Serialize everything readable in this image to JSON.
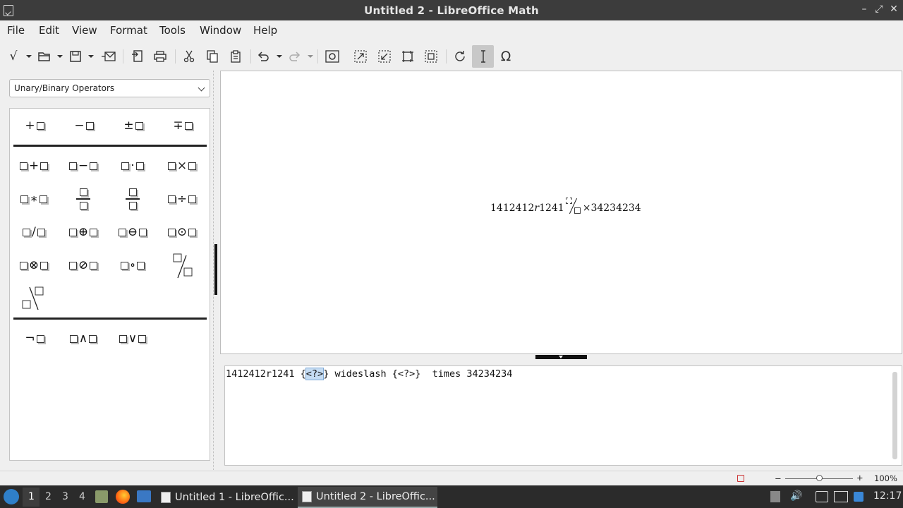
{
  "window": {
    "title": "Untitled 2 - LibreOffice Math",
    "controls": {
      "minimize": "–",
      "restore": "⤢",
      "close": "✕"
    }
  },
  "menubar": [
    "File",
    "Edit",
    "View",
    "Format",
    "Tools",
    "Window",
    "Help"
  ],
  "toolbar": {
    "icons": [
      "formula-cursor-icon",
      "open-icon",
      "save-icon",
      "email-icon",
      "export-pdf-icon",
      "print-icon",
      "cut-icon",
      "copy-icon",
      "paste-icon",
      "undo-icon",
      "redo-icon",
      "zoom-in-icon",
      "zoom-out-icon",
      "show-all-icon",
      "zoom-100-icon",
      "zoom-optimal-icon",
      "update-icon",
      "formula-cursor-toggle-icon",
      "symbols-icon"
    ],
    "symbols_glyph": "Ω",
    "sqrt_glyph": "√"
  },
  "elements_panel": {
    "category": "Unary/Binary Operators",
    "unary_row": [
      "+",
      "−",
      "±",
      "∓"
    ],
    "binary_rows": [
      [
        "+",
        "−",
        "·",
        "×"
      ],
      [
        "∗",
        "frac",
        "frac",
        "÷"
      ],
      [
        "/",
        "⊕",
        "⊖",
        "⊙"
      ],
      [
        "⊗",
        "⊘",
        "∘",
        "wideslash"
      ],
      [
        "widebslash"
      ]
    ],
    "logic_row": [
      "¬",
      "∧",
      "∨"
    ]
  },
  "formula_view": {
    "rendered_prefix": "1412412",
    "rendered_var": "r",
    "rendered_num": "1241",
    "rendered_times": "×",
    "rendered_suffix": "34234234"
  },
  "command_editor": {
    "before": "1412412r1241 {",
    "selected": "<?>",
    "after": "} wideslash {<?>}  times 34234234"
  },
  "statusbar": {
    "zoom": "100%",
    "zoom_minus": "−",
    "zoom_plus": "+",
    "zoom_level_fraction": 0.5
  },
  "taskbar": {
    "workspaces": [
      "1",
      "2",
      "3",
      "4"
    ],
    "active_workspace": "1",
    "tasks": [
      {
        "label": "Untitled 1 - LibreOffic...",
        "active": false
      },
      {
        "label": "Untitled 2 - LibreOffic...",
        "active": true
      }
    ],
    "clock": "12:17"
  }
}
